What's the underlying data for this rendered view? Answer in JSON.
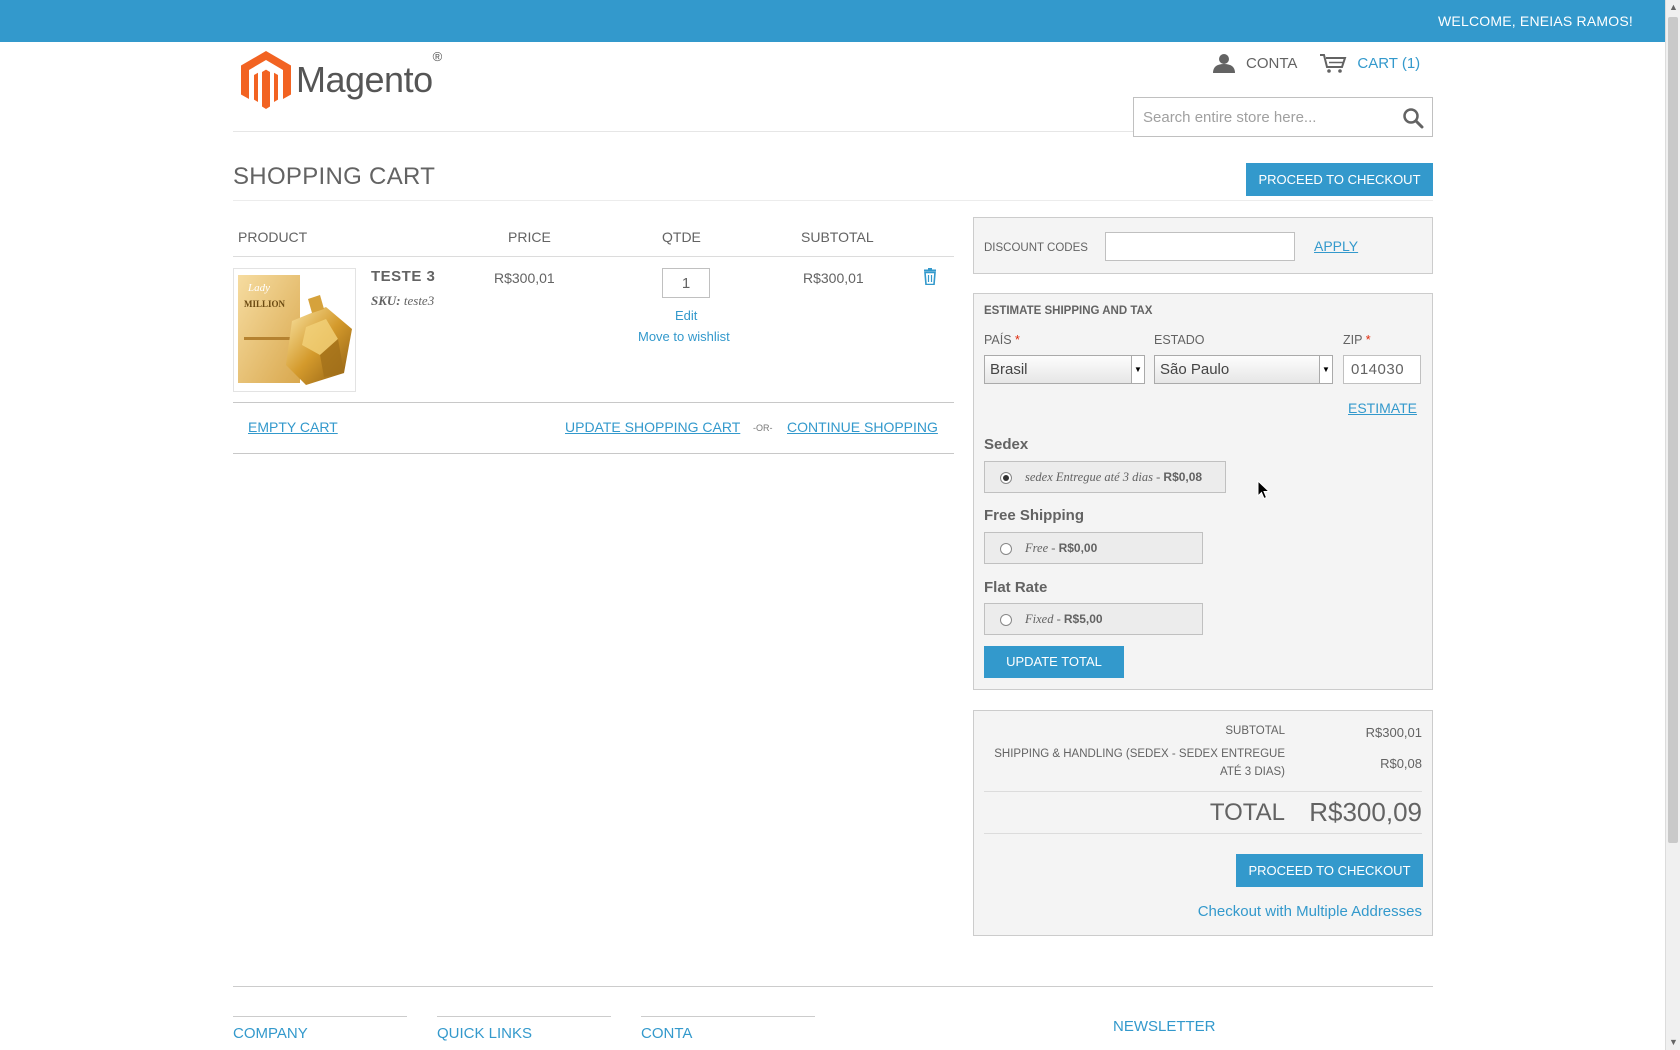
{
  "header": {
    "welcome": "WELCOME, ENEIAS RAMOS!",
    "logo_text": "Magento",
    "logo_reg": "®",
    "account_label": "CONTA",
    "cart_label": "CART (1)",
    "search_placeholder": "Search entire store here..."
  },
  "page": {
    "title": "SHOPPING CART",
    "proceed_top": "PROCEED TO CHECKOUT"
  },
  "cart": {
    "columns": [
      "PRODUCT",
      "PRICE",
      "QTDE",
      "SUBTOTAL"
    ],
    "items": [
      {
        "name": "TESTE 3",
        "sku_label": "SKU:",
        "sku": "teste3",
        "price": "R$300,01",
        "qty": "1",
        "edit": "Edit",
        "wishlist": "Move to wishlist",
        "subtotal": "R$300,01"
      }
    ],
    "empty_cart": "EMPTY CART",
    "update_cart": "UPDATE SHOPPING CART",
    "or": "-OR-",
    "continue": "CONTINUE SHOPPING"
  },
  "discount": {
    "label": "DISCOUNT CODES",
    "value": "",
    "apply": "APPLY"
  },
  "shipping": {
    "title": "ESTIMATE SHIPPING AND TAX",
    "country_label": "PAÍS",
    "country_value": "Brasil",
    "state_label": "ESTADO",
    "state_value": "São Paulo",
    "zip_label": "ZIP",
    "zip_value": "014030",
    "required_mark": "*",
    "estimate": "ESTIMATE",
    "carriers": [
      {
        "name": "Sedex",
        "method": "sedex Entregue até 3 dias",
        "price": "R$0,08",
        "selected": true
      },
      {
        "name": "Free Shipping",
        "method": "Free",
        "price": "R$0,00",
        "selected": false
      },
      {
        "name": "Flat Rate",
        "method": "Fixed",
        "price": "R$5,00",
        "selected": false
      }
    ],
    "dash": " - ",
    "update_total": "UPDATE TOTAL"
  },
  "totals": {
    "subtotal_label": "SUBTOTAL",
    "subtotal_value": "R$300,01",
    "shipping_label_1": "SHIPPING & HANDLING (SEDEX - SEDEX ENTREGUE",
    "shipping_label_2": "ATÉ 3 DIAS)",
    "shipping_value": "R$0,08",
    "total_label": "TOTAL",
    "total_value": "R$300,09",
    "proceed": "PROCEED TO CHECKOUT",
    "multi": "Checkout with Multiple Addresses"
  },
  "footer": {
    "columns": [
      "COMPANY",
      "QUICK LINKS",
      "CONTA"
    ],
    "newsletter": "NEWSLETTER"
  },
  "colors": {
    "accent": "#3399cc",
    "logo_orange": "#f26322",
    "text": "#636363"
  }
}
